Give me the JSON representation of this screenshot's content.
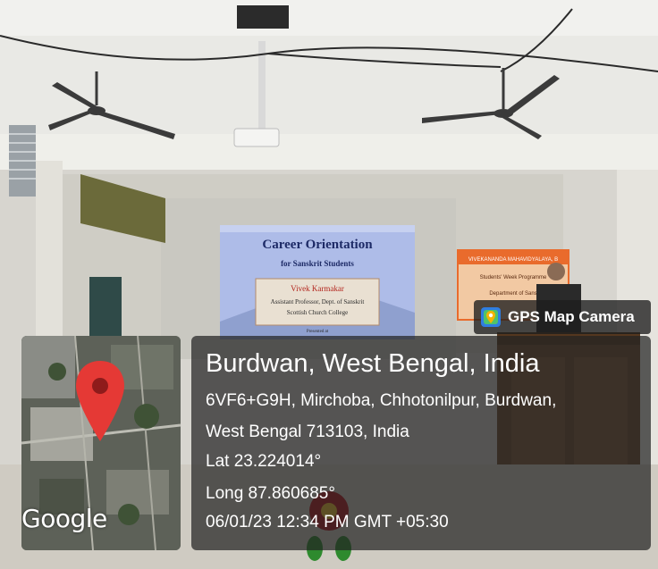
{
  "photo": {
    "slide": {
      "title": "Career Orientation",
      "subtitle": "for Sanskrit Students",
      "presenter": "Vivek Karmakar",
      "role": "Assistant Professor, Dept. of Sanskrit",
      "college": "Scottish Church College",
      "footer": "Presented at"
    },
    "banner": {
      "line1": "VIVEKANANDA MAHAVIDYALAYA, B",
      "line2": "Students' Week Programme",
      "line3": "Department of Sans"
    }
  },
  "overlay": {
    "app_name": "GPS Map Camera",
    "app_icon": "gps-camera-icon",
    "map_logo": "Google",
    "pin_icon": "map-pin-icon",
    "location_title": "Burdwan, West Bengal, India",
    "address_line1": "6VF6+G9H, Mirchoba, Chhotonilpur, Burdwan,",
    "address_line2": "West Bengal 713103, India",
    "latitude": "Lat 23.224014°",
    "longitude": "Long 87.860685°",
    "datetime": "06/01/23 12:34 PM GMT +05:30"
  },
  "colors": {
    "pin": "#e53935",
    "overlay_bg": "#232323",
    "slide_blue": "#7c93d6",
    "banner_orange": "#e96b2c"
  }
}
